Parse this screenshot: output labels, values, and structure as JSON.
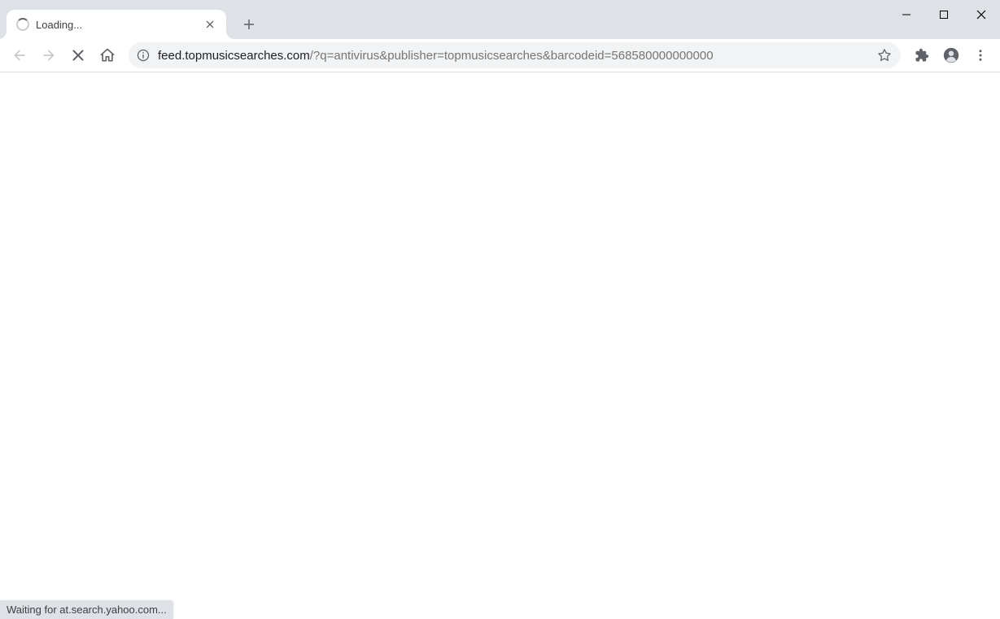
{
  "tab": {
    "title": "Loading..."
  },
  "url": {
    "domain": "feed.topmusicsearches.com",
    "path": "/?q=antivirus&publisher=topmusicsearches&barcodeid=568580000000000"
  },
  "status": {
    "message": "Waiting for at.search.yahoo.com..."
  }
}
